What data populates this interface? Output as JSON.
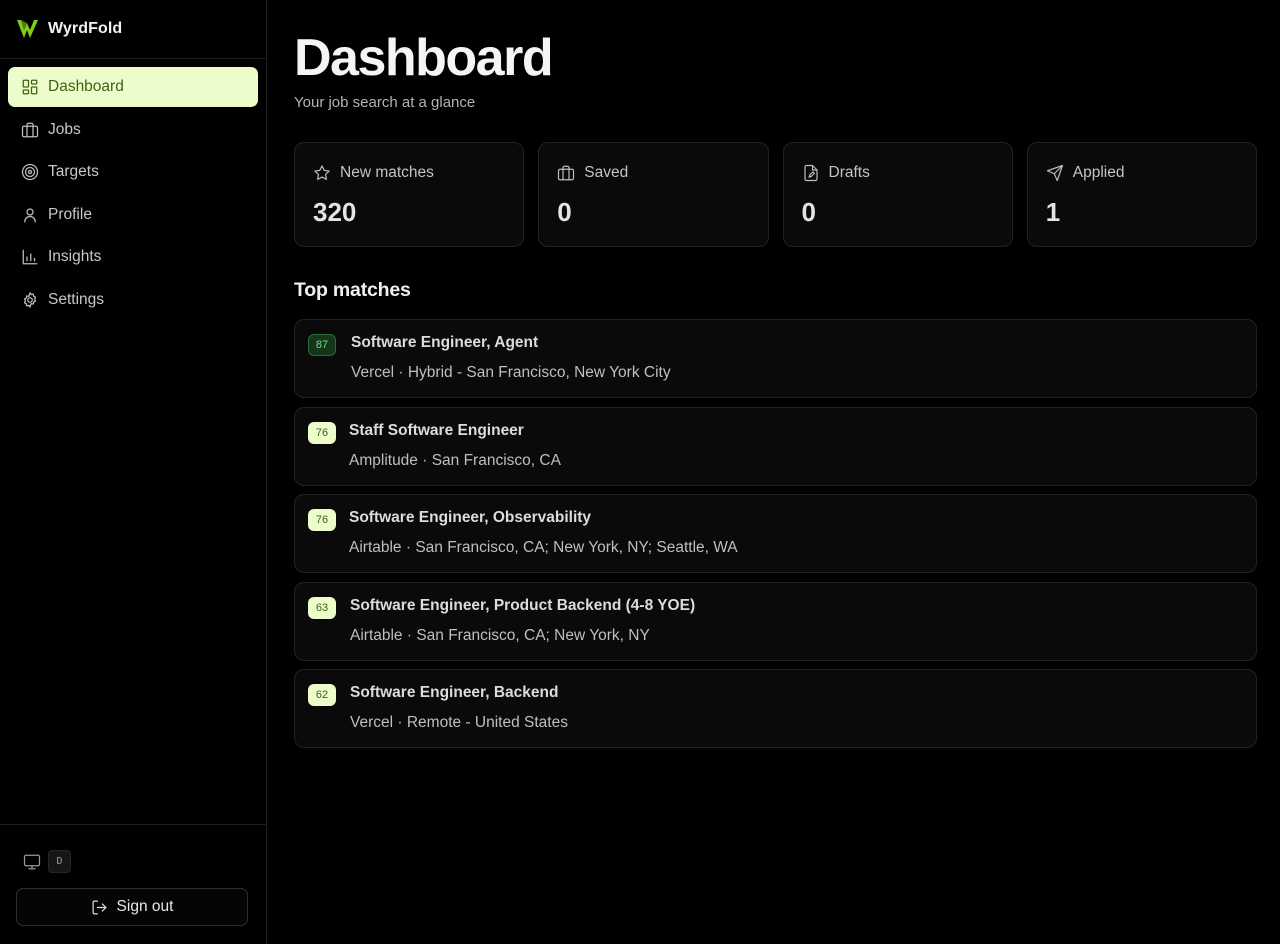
{
  "brand": {
    "name": "WyrdFold",
    "accent": "#84cc16"
  },
  "sidebar": {
    "items": [
      {
        "label": "Dashboard",
        "icon": "dashboard-icon",
        "active": true
      },
      {
        "label": "Jobs",
        "icon": "briefcase-icon",
        "active": false
      },
      {
        "label": "Targets",
        "icon": "target-icon",
        "active": false
      },
      {
        "label": "Profile",
        "icon": "user-icon",
        "active": false
      },
      {
        "label": "Insights",
        "icon": "bar-chart-icon",
        "active": false
      },
      {
        "label": "Settings",
        "icon": "gear-icon",
        "active": false
      }
    ],
    "theme_key": "D",
    "sign_out_label": "Sign out"
  },
  "header": {
    "title": "Dashboard",
    "subtitle": "Your job search at a glance"
  },
  "stats": [
    {
      "label": "New matches",
      "value": "320",
      "icon": "star-icon"
    },
    {
      "label": "Saved",
      "value": "0",
      "icon": "briefcase-icon"
    },
    {
      "label": "Drafts",
      "value": "0",
      "icon": "file-edit-icon"
    },
    {
      "label": "Applied",
      "value": "1",
      "icon": "send-icon"
    }
  ],
  "top_matches": {
    "title": "Top matches",
    "items": [
      {
        "score": "87",
        "title": "Software Engineer, Agent",
        "subtitle": "Vercel · Hybrid - San Francisco, New York City",
        "highlight": true
      },
      {
        "score": "76",
        "title": "Staff Software Engineer",
        "subtitle": "Amplitude · San Francisco, CA",
        "highlight": false
      },
      {
        "score": "76",
        "title": "Software Engineer, Observability",
        "subtitle": "Airtable · San Francisco, CA; New York, NY; Seattle, WA",
        "highlight": false
      },
      {
        "score": "63",
        "title": "Software Engineer, Product Backend (4-8 YOE)",
        "subtitle": "Airtable · San Francisco, CA; New York, NY",
        "highlight": false
      },
      {
        "score": "62",
        "title": "Software Engineer, Backend",
        "subtitle": "Vercel · Remote - United States",
        "highlight": false
      }
    ]
  }
}
